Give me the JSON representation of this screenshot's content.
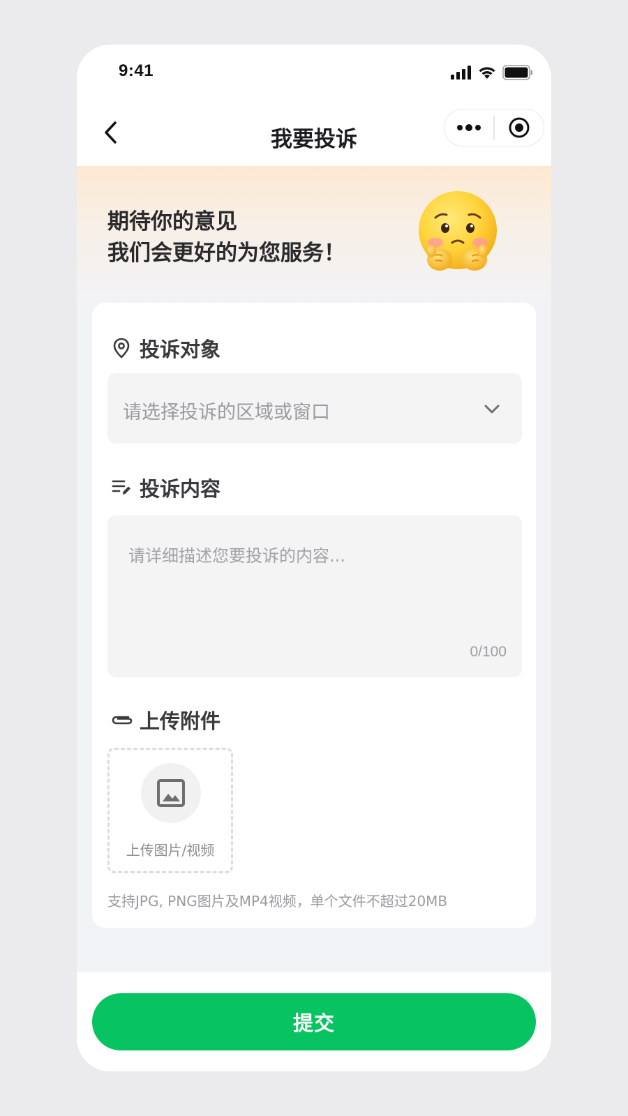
{
  "status_bar": {
    "time": "9:41",
    "icons": [
      "signal-icon",
      "wifi-icon",
      "battery-icon"
    ]
  },
  "nav": {
    "title": "我要投诉",
    "icons": [
      "back-icon",
      "more-icon",
      "close-mini-program-icon"
    ]
  },
  "banner": {
    "line1": "期待你的意见",
    "line2": "我们会更好的为您服务！",
    "emoji": "pleading-face-emoji"
  },
  "form": {
    "target": {
      "label": "投诉对象",
      "icon": "location-icon",
      "placeholder": "请选择投诉的区域或窗口",
      "dropdown_icon": "chevron-down-icon"
    },
    "content": {
      "label": "投诉内容",
      "icon": "edit-lines-icon",
      "placeholder": "请详细描述您要投诉的内容...",
      "counter": "0/100"
    },
    "attachment": {
      "label": "上传附件",
      "icon": "paperclip-icon",
      "upload_label": "上传图片/视频",
      "upload_icon": "image-icon",
      "hint": "支持JPG, PNG图片及MP4视频，单个文件不超过20MB"
    }
  },
  "footer": {
    "submit_label": "提交"
  },
  "colors": {
    "accent": "#08c361",
    "page_bg": "#f2f3f6",
    "banner_top": "#fde9d2"
  }
}
